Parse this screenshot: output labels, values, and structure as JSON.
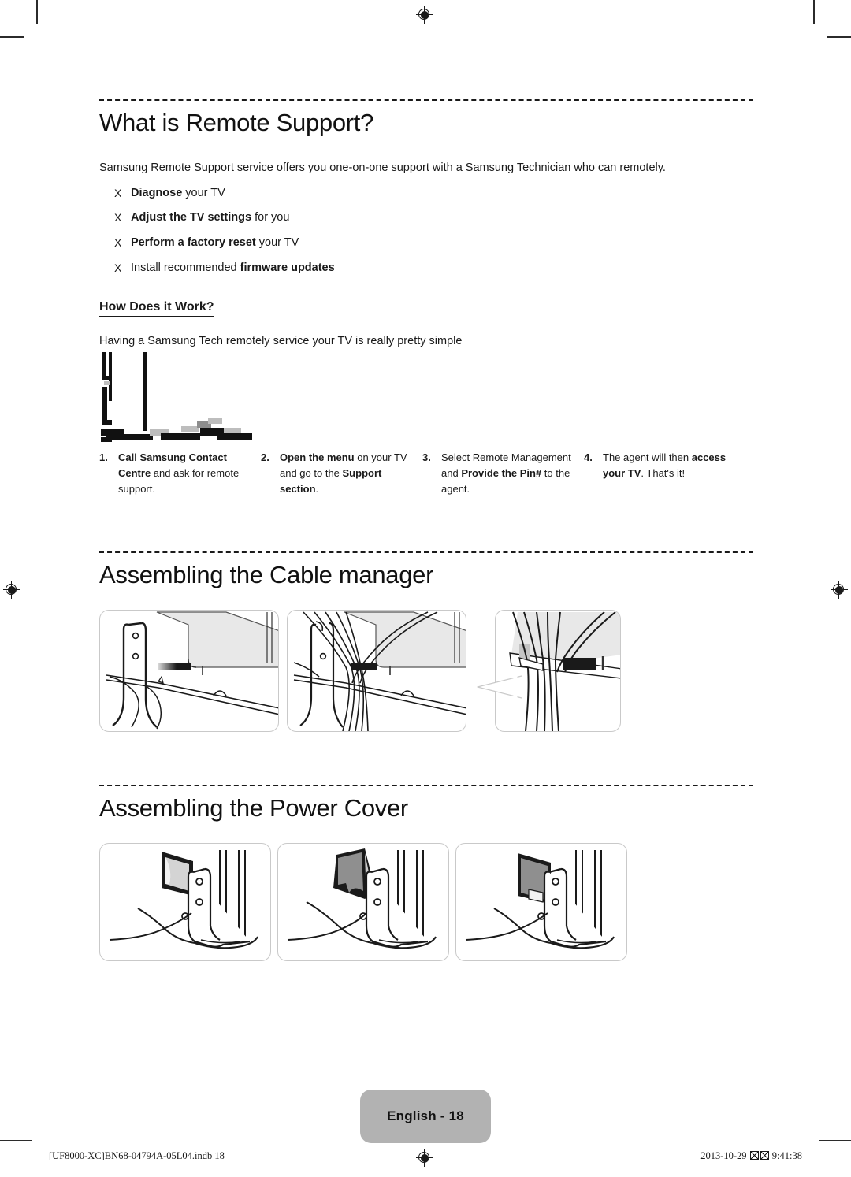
{
  "document": {
    "title": "What is Remote Support?",
    "page_label": "English - 18"
  },
  "remote_support": {
    "heading": "What is Remote Support?",
    "intro": "Samsung Remote Support service offers you one-on-one support with a Samsung Technician who can remotely.",
    "bullet_marker": "X",
    "features": [
      {
        "bold_lead": "Diagnose",
        "rest": " your TV",
        "lead_first": true
      },
      {
        "bold_lead": "Adjust the TV settings",
        "rest": " for you",
        "lead_first": true
      },
      {
        "bold_lead": "Perform a factory reset",
        "rest": " your TV",
        "lead_first": true
      },
      {
        "plain_lead": "Install recommended ",
        "bold_tail": "firmware updates",
        "lead_first": false
      }
    ],
    "subheading": "How Does it Work?",
    "sub_intro": "Having a Samsung Tech remotely service your TV is really pretty simple",
    "steps": [
      {
        "number": "1.",
        "parts": [
          {
            "text": "Call Samsung Contact Centre",
            "bold": true
          },
          {
            "text": " and ask for remote support.",
            "bold": false
          }
        ]
      },
      {
        "number": "2.",
        "parts": [
          {
            "text": "Open the menu",
            "bold": true
          },
          {
            "text": " on your TV and go to the ",
            "bold": false
          },
          {
            "text": "Support section",
            "bold": true
          },
          {
            "text": ".",
            "bold": false
          }
        ]
      },
      {
        "number": "3.",
        "parts": [
          {
            "text": "Select Remote Management and ",
            "bold": false
          },
          {
            "text": "Provide the Pin#",
            "bold": true
          },
          {
            "text": " to the agent.",
            "bold": false
          }
        ]
      },
      {
        "number": "4.",
        "parts": [
          {
            "text": "The agent will then ",
            "bold": false
          },
          {
            "text": "access your TV",
            "bold": true
          },
          {
            "text": ". That's it!",
            "bold": false
          }
        ]
      }
    ]
  },
  "cable_manager": {
    "heading": "Assembling the Cable manager",
    "figures": [
      {
        "name": "tv-stand-cables-step-1"
      },
      {
        "name": "tv-stand-cables-step-2"
      },
      {
        "name": "cable-manager-detail-zoom"
      }
    ]
  },
  "power_cover": {
    "heading": "Assembling the Power Cover",
    "figures": [
      {
        "name": "power-cover-step-1"
      },
      {
        "name": "power-cover-step-2"
      },
      {
        "name": "power-cover-step-3"
      }
    ]
  },
  "footer": {
    "file_reference": "[UF8000-XC]BN68-04794A-05L04.indb   18",
    "date": "2013-10-29",
    "time": "9:41:38",
    "missing_glyph_count": 2
  },
  "colors": {
    "badge_background": "#b2b2b2",
    "text": "#1a1a1a",
    "rule": "#1a1a1a",
    "panel_border": "#c9c9c9",
    "illustration_fill": "#9a9a9a"
  }
}
